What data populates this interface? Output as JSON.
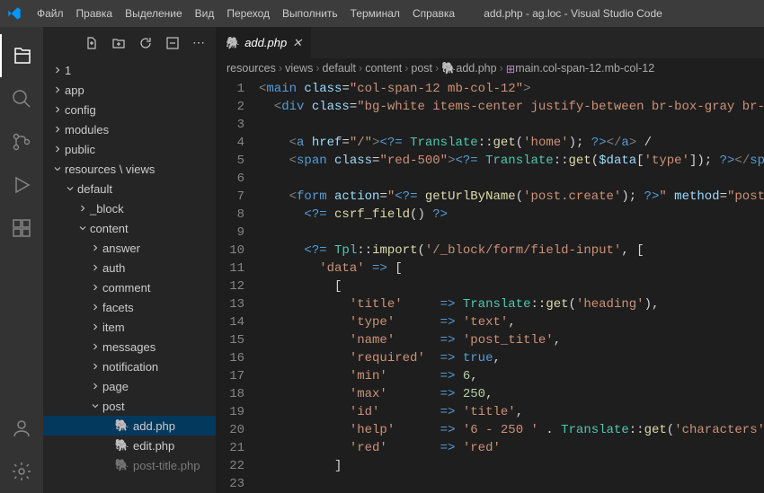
{
  "title": "add.php - ag.loc - Visual Studio Code",
  "menu": [
    "Файл",
    "Правка",
    "Выделение",
    "Вид",
    "Переход",
    "Выполнить",
    "Терминал",
    "Справка"
  ],
  "tree": [
    {
      "d": 0,
      "t": "f",
      "e": "c",
      "l": "1"
    },
    {
      "d": 0,
      "t": "f",
      "e": "c",
      "l": "app"
    },
    {
      "d": 0,
      "t": "f",
      "e": "c",
      "l": "config"
    },
    {
      "d": 0,
      "t": "f",
      "e": "c",
      "l": "modules"
    },
    {
      "d": 0,
      "t": "f",
      "e": "c",
      "l": "public"
    },
    {
      "d": 0,
      "t": "f",
      "e": "o",
      "l": "resources \\ views"
    },
    {
      "d": 1,
      "t": "f",
      "e": "o",
      "l": "default"
    },
    {
      "d": 2,
      "t": "f",
      "e": "c",
      "l": "_block"
    },
    {
      "d": 2,
      "t": "f",
      "e": "o",
      "l": "content"
    },
    {
      "d": 3,
      "t": "f",
      "e": "c",
      "l": "answer"
    },
    {
      "d": 3,
      "t": "f",
      "e": "c",
      "l": "auth"
    },
    {
      "d": 3,
      "t": "f",
      "e": "c",
      "l": "comment"
    },
    {
      "d": 3,
      "t": "f",
      "e": "c",
      "l": "facets"
    },
    {
      "d": 3,
      "t": "f",
      "e": "c",
      "l": "item"
    },
    {
      "d": 3,
      "t": "f",
      "e": "c",
      "l": "messages"
    },
    {
      "d": 3,
      "t": "f",
      "e": "c",
      "l": "notification"
    },
    {
      "d": 3,
      "t": "f",
      "e": "c",
      "l": "page"
    },
    {
      "d": 3,
      "t": "f",
      "e": "o",
      "l": "post"
    },
    {
      "d": 4,
      "t": "php",
      "l": "add.php",
      "sel": true
    },
    {
      "d": 4,
      "t": "php",
      "l": "edit.php"
    },
    {
      "d": 4,
      "t": "php",
      "l": "post-title.php",
      "cut": true
    }
  ],
  "tab": {
    "label": "add.php"
  },
  "breadcrumbs": [
    "resources",
    "views",
    "default",
    "content",
    "post",
    "add.php",
    "main.col-span-12.mb-col-12"
  ],
  "lines": 23,
  "code": [
    [
      [
        "t-tag",
        "<"
      ],
      [
        "t-name",
        "main "
      ],
      [
        "t-attr",
        "class"
      ],
      [
        "t-op",
        "="
      ],
      [
        "t-str",
        "\"col-span-12 mb-col-12\""
      ],
      [
        "t-tag",
        ">"
      ]
    ],
    [
      [
        "",
        "  "
      ],
      [
        "t-tag",
        "<"
      ],
      [
        "t-name",
        "div "
      ],
      [
        "t-attr",
        "class"
      ],
      [
        "t-op",
        "="
      ],
      [
        "t-str",
        "\"bg-white items-center justify-between br-box-gray br-"
      ]
    ],
    [
      [
        "",
        ""
      ]
    ],
    [
      [
        "",
        "    "
      ],
      [
        "t-tag",
        "<"
      ],
      [
        "t-name",
        "a "
      ],
      [
        "t-attr",
        "href"
      ],
      [
        "t-op",
        "="
      ],
      [
        "t-str",
        "\"/\""
      ],
      [
        "t-tag",
        ">"
      ],
      [
        "t-name",
        "<?= "
      ],
      [
        "t-cls",
        "Translate"
      ],
      [
        "t-op",
        "::"
      ],
      [
        "t-fn",
        "get"
      ],
      [
        "t-op",
        "("
      ],
      [
        "t-str",
        "'home'"
      ],
      [
        "t-op",
        ")"
      ],
      [
        "t-op",
        "; "
      ],
      [
        "t-name",
        "?>"
      ],
      [
        "t-tag",
        "</"
      ],
      [
        "t-name",
        "a"
      ],
      [
        "t-tag",
        ">"
      ],
      [
        "",
        " /"
      ]
    ],
    [
      [
        "",
        "    "
      ],
      [
        "t-tag",
        "<"
      ],
      [
        "t-name",
        "span "
      ],
      [
        "t-attr",
        "class"
      ],
      [
        "t-op",
        "="
      ],
      [
        "t-str",
        "\"red-500\""
      ],
      [
        "t-tag",
        ">"
      ],
      [
        "t-name",
        "<?= "
      ],
      [
        "t-cls",
        "Translate"
      ],
      [
        "t-op",
        "::"
      ],
      [
        "t-fn",
        "get"
      ],
      [
        "t-op",
        "("
      ],
      [
        "t-var",
        "$data"
      ],
      [
        "t-op",
        "["
      ],
      [
        "t-str",
        "'type'"
      ],
      [
        "t-op",
        "]); "
      ],
      [
        "t-name",
        "?>"
      ],
      [
        "t-tag",
        "</"
      ],
      [
        "t-name",
        "sp"
      ]
    ],
    [
      [
        "",
        ""
      ]
    ],
    [
      [
        "",
        "    "
      ],
      [
        "t-tag",
        "<"
      ],
      [
        "t-name",
        "form "
      ],
      [
        "t-attr",
        "action"
      ],
      [
        "t-op",
        "="
      ],
      [
        "t-str",
        "\""
      ],
      [
        "t-name",
        "<?= "
      ],
      [
        "t-fn",
        "getUrlByName"
      ],
      [
        "t-op",
        "("
      ],
      [
        "t-str",
        "'post.create'"
      ],
      [
        "t-op",
        ")"
      ],
      [
        "t-op",
        "; "
      ],
      [
        "t-name",
        "?>"
      ],
      [
        "t-str",
        "\" "
      ],
      [
        "t-attr",
        "method"
      ],
      [
        "t-op",
        "="
      ],
      [
        "t-str",
        "\"post"
      ]
    ],
    [
      [
        "",
        "      "
      ],
      [
        "t-name",
        "<?= "
      ],
      [
        "t-fn",
        "csrf_field"
      ],
      [
        "t-op",
        "() "
      ],
      [
        "t-name",
        "?>"
      ]
    ],
    [
      [
        "",
        ""
      ]
    ],
    [
      [
        "",
        "      "
      ],
      [
        "t-name",
        "<?= "
      ],
      [
        "t-cls",
        "Tpl"
      ],
      [
        "t-op",
        "::"
      ],
      [
        "t-fn",
        "import"
      ],
      [
        "t-op",
        "("
      ],
      [
        "t-str",
        "'/_block/form/field-input'"
      ],
      [
        "t-op",
        ", ["
      ]
    ],
    [
      [
        "",
        "        "
      ],
      [
        "t-str",
        "'data'"
      ],
      [
        "",
        " "
      ],
      [
        "t-arr",
        "=>"
      ],
      [
        "",
        " ["
      ]
    ],
    [
      [
        "",
        "          ["
      ]
    ],
    [
      [
        "",
        "            "
      ],
      [
        "t-str",
        "'title'"
      ],
      [
        "",
        "     "
      ],
      [
        "t-arr",
        "=>"
      ],
      [
        "",
        " "
      ],
      [
        "t-cls",
        "Translate"
      ],
      [
        "t-op",
        "::"
      ],
      [
        "t-fn",
        "get"
      ],
      [
        "t-op",
        "("
      ],
      [
        "t-str",
        "'heading'"
      ],
      [
        "t-op",
        ")"
      ],
      [
        "t-op",
        ","
      ]
    ],
    [
      [
        "",
        "            "
      ],
      [
        "t-str",
        "'type'"
      ],
      [
        "",
        "      "
      ],
      [
        "t-arr",
        "=>"
      ],
      [
        "",
        " "
      ],
      [
        "t-str",
        "'text'"
      ],
      [
        "t-op",
        ","
      ]
    ],
    [
      [
        "",
        "            "
      ],
      [
        "t-str",
        "'name'"
      ],
      [
        "",
        "      "
      ],
      [
        "t-arr",
        "=>"
      ],
      [
        "",
        " "
      ],
      [
        "t-str",
        "'post_title'"
      ],
      [
        "t-op",
        ","
      ]
    ],
    [
      [
        "",
        "            "
      ],
      [
        "t-str",
        "'required'"
      ],
      [
        "",
        "  "
      ],
      [
        "t-arr",
        "=>"
      ],
      [
        "",
        " "
      ],
      [
        "t-kw",
        "true"
      ],
      [
        "t-op",
        ","
      ]
    ],
    [
      [
        "",
        "            "
      ],
      [
        "t-str",
        "'min'"
      ],
      [
        "",
        "       "
      ],
      [
        "t-arr",
        "=>"
      ],
      [
        "",
        " "
      ],
      [
        "t-num",
        "6"
      ],
      [
        "t-op",
        ","
      ]
    ],
    [
      [
        "",
        "            "
      ],
      [
        "t-str",
        "'max'"
      ],
      [
        "",
        "       "
      ],
      [
        "t-arr",
        "=>"
      ],
      [
        "",
        " "
      ],
      [
        "t-num",
        "250"
      ],
      [
        "t-op",
        ","
      ]
    ],
    [
      [
        "",
        "            "
      ],
      [
        "t-str",
        "'id'"
      ],
      [
        "",
        "        "
      ],
      [
        "t-arr",
        "=>"
      ],
      [
        "",
        " "
      ],
      [
        "t-str",
        "'title'"
      ],
      [
        "t-op",
        ","
      ]
    ],
    [
      [
        "",
        "            "
      ],
      [
        "t-str",
        "'help'"
      ],
      [
        "",
        "      "
      ],
      [
        "t-arr",
        "=>"
      ],
      [
        "",
        " "
      ],
      [
        "t-str",
        "'6 - 250 '"
      ],
      [
        "",
        " . "
      ],
      [
        "t-cls",
        "Translate"
      ],
      [
        "t-op",
        "::"
      ],
      [
        "t-fn",
        "get"
      ],
      [
        "t-op",
        "("
      ],
      [
        "t-str",
        "'characters'"
      ]
    ],
    [
      [
        "",
        "            "
      ],
      [
        "t-str",
        "'red'"
      ],
      [
        "",
        "       "
      ],
      [
        "t-arr",
        "=>"
      ],
      [
        "",
        " "
      ],
      [
        "t-str",
        "'red'"
      ]
    ],
    [
      [
        "",
        "          ]"
      ]
    ],
    [
      [
        "",
        ""
      ]
    ]
  ]
}
